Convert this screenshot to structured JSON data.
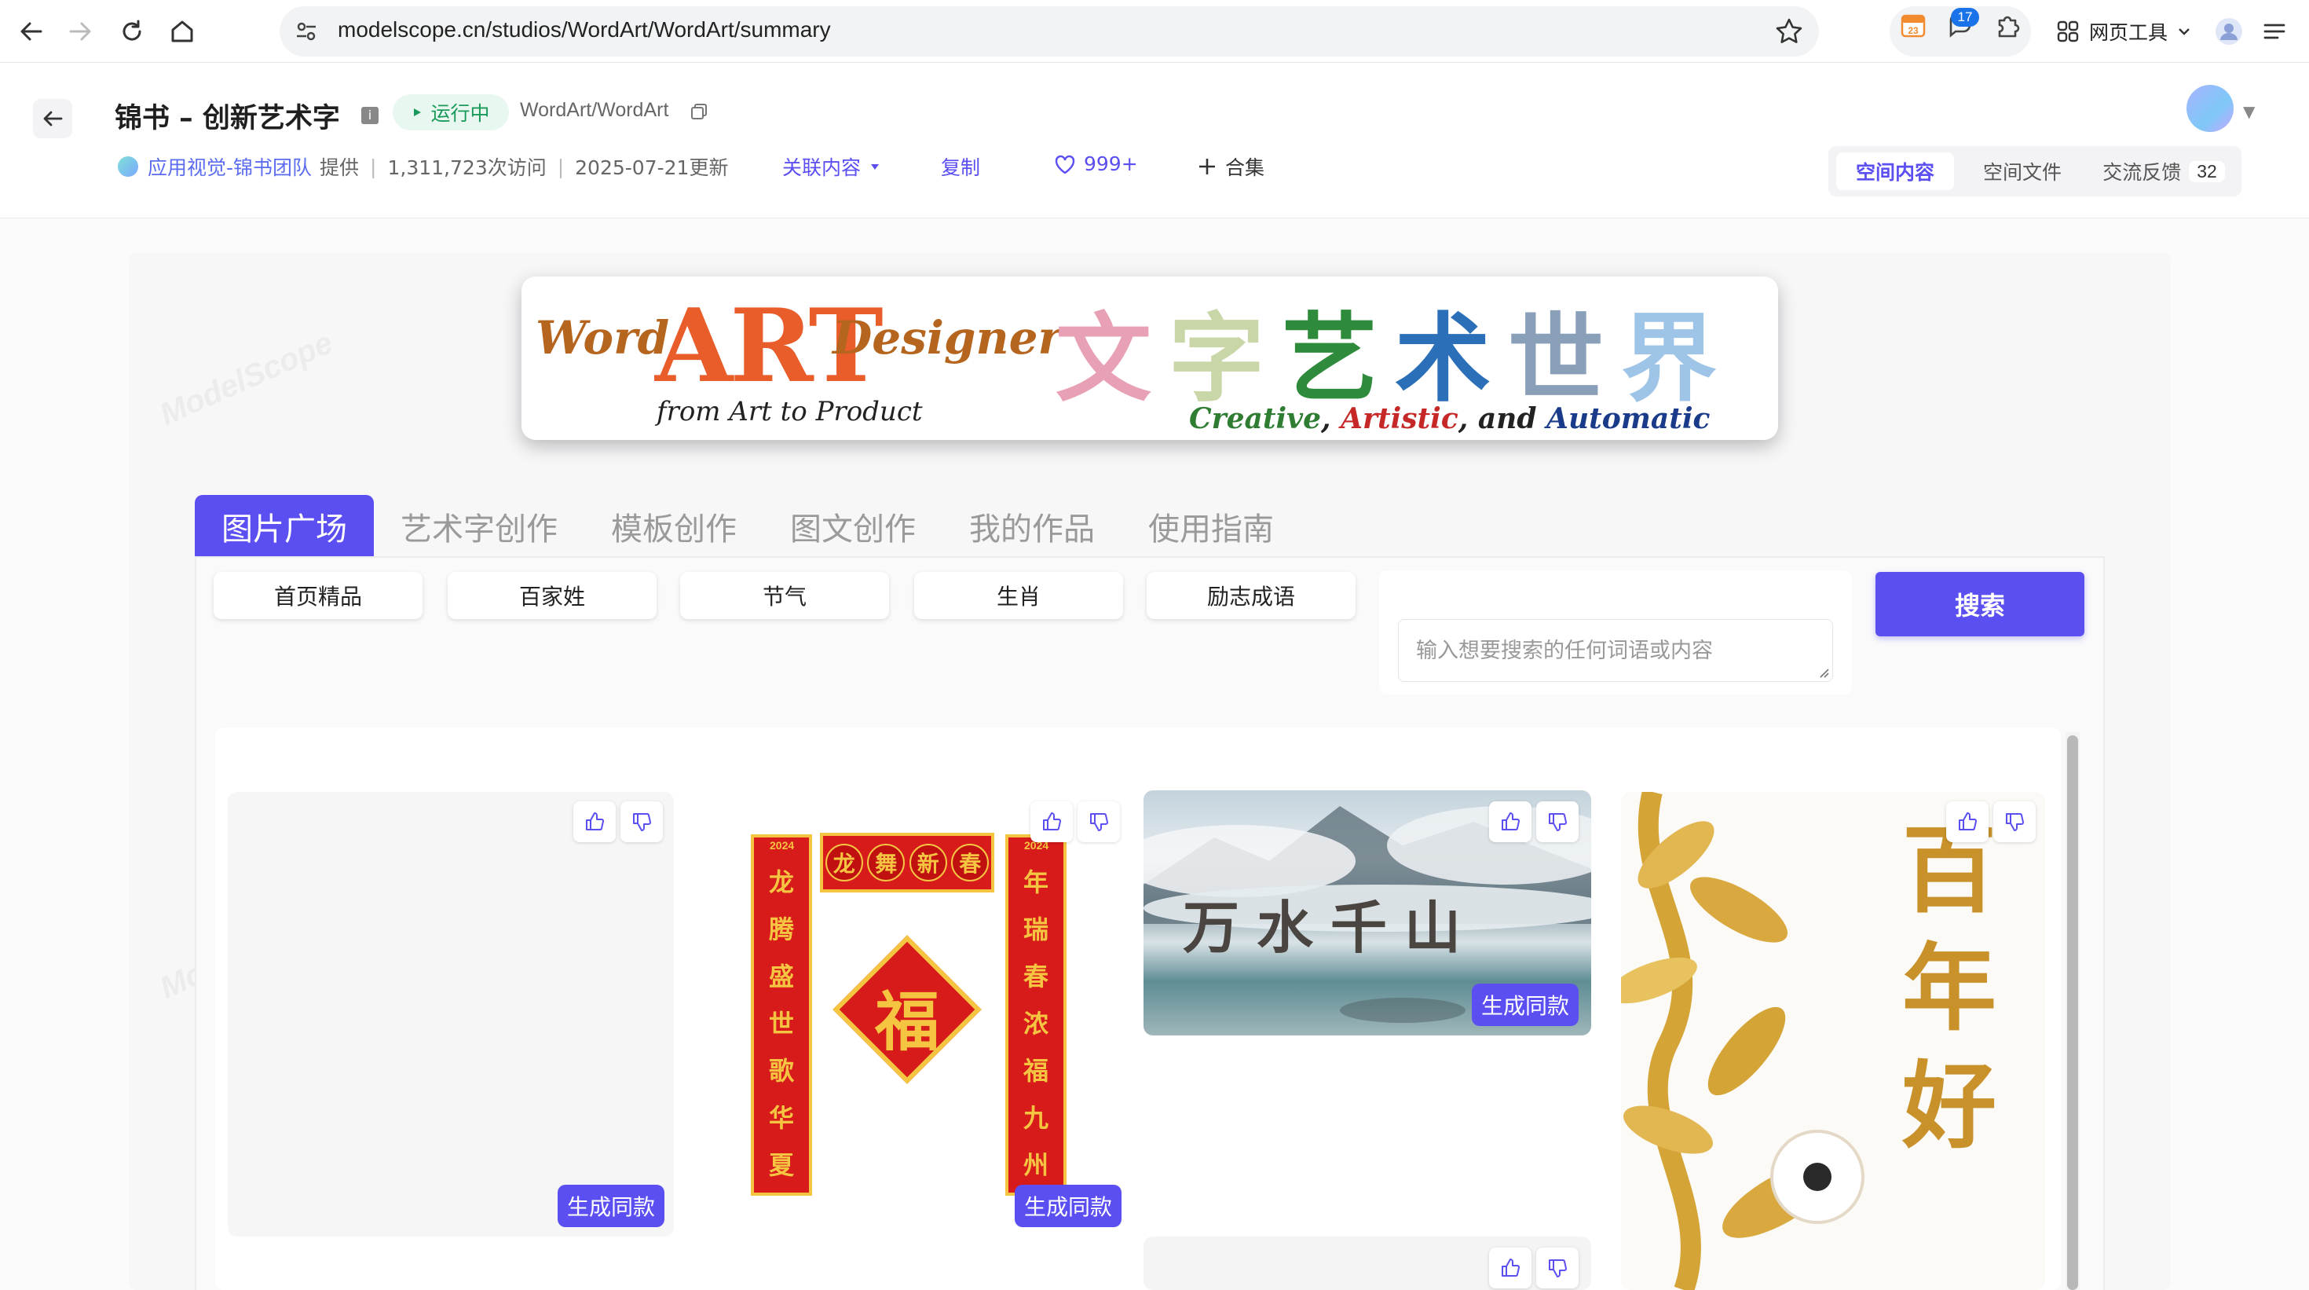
{
  "browser": {
    "url": "modelscope.cn/studios/WordArt/WordArt/summary",
    "extension_badge": "17",
    "calendar_day": "23",
    "web_tools_label": "网页工具"
  },
  "header": {
    "title": "锦书 – 创新艺术字",
    "status": "运行中",
    "repo_path": "WordArt/WordArt",
    "team_name": "应用视觉-锦书团队",
    "provided_by": "提供",
    "visits": "1,311,723次访问",
    "updated": "2025-07-21更新",
    "related_label": "关联内容",
    "copy_label": "复制",
    "likes": "999+",
    "collection_label": "合集",
    "segments": [
      {
        "label": "空间内容",
        "active": true
      },
      {
        "label": "空间文件",
        "active": false
      },
      {
        "label": "交流反馈",
        "count": "32",
        "active": false
      }
    ]
  },
  "banner": {
    "word": "Word",
    "art": "ART",
    "designer": "Designer",
    "subtitle": "from Art to Product",
    "tagline_creative": "Creative",
    "tagline_sep1": ", ",
    "tagline_artistic": "Artistic",
    "tagline_sep2": ", and ",
    "tagline_automatic": "Automatic",
    "chars": [
      "文",
      "字",
      "艺",
      "术",
      "世",
      "界"
    ]
  },
  "main_tabs": [
    {
      "label": "图片广场",
      "active": true
    },
    {
      "label": "艺术字创作",
      "active": false
    },
    {
      "label": "模板创作",
      "active": false
    },
    {
      "label": "图文创作",
      "active": false
    },
    {
      "label": "我的作品",
      "active": false
    },
    {
      "label": "使用指南",
      "active": false
    }
  ],
  "filters": [
    "首页精品",
    "百家姓",
    "节气",
    "生肖",
    "励志成语"
  ],
  "search": {
    "placeholder": "输入想要搜索的任何词语或内容",
    "button_label": "搜索"
  },
  "gallery": {
    "generate_label": "生成同款",
    "couplet_left": [
      "龙",
      "腾",
      "盛",
      "世",
      "歌",
      "华",
      "夏"
    ],
    "couplet_right": [
      "年",
      "瑞",
      "春",
      "浓",
      "福",
      "九",
      "州"
    ],
    "couplet_top": [
      "龙",
      "舞",
      "新",
      "春"
    ],
    "couplet_year": "2024",
    "fu_char": "福",
    "landscape_text": "万水千山",
    "gold_text": "百年好"
  },
  "watermark_text": "ModelScope",
  "colors": {
    "accent": "#5b4ff2",
    "status_green": "#1a9a5a",
    "couplet_red": "#d71a1a",
    "gold": "#f5c542"
  }
}
